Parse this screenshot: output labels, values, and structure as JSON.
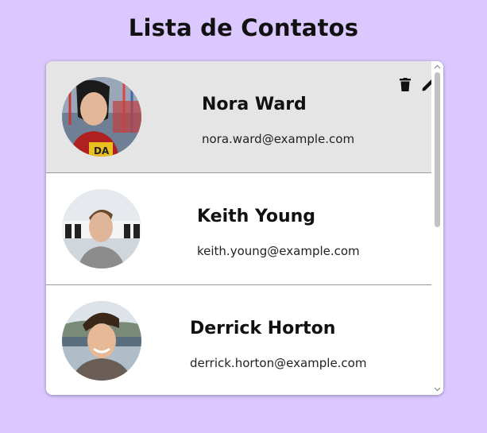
{
  "title": "Lista de Contatos",
  "contacts": [
    {
      "name": "Nora Ward",
      "email": "nora.ward@example.com",
      "selected": true
    },
    {
      "name": "Keith Young",
      "email": "keith.young@example.com",
      "selected": false
    },
    {
      "name": "Derrick Horton",
      "email": "derrick.horton@example.com",
      "selected": false
    }
  ],
  "icons": {
    "delete": "trash-icon",
    "edit": "pencil-icon",
    "scroll_up": "chevron-up-icon",
    "scroll_down": "chevron-down-icon"
  },
  "colors": {
    "background": "#dbc8ff",
    "selected_row": "#e5e5e5",
    "panel": "#ffffff"
  }
}
